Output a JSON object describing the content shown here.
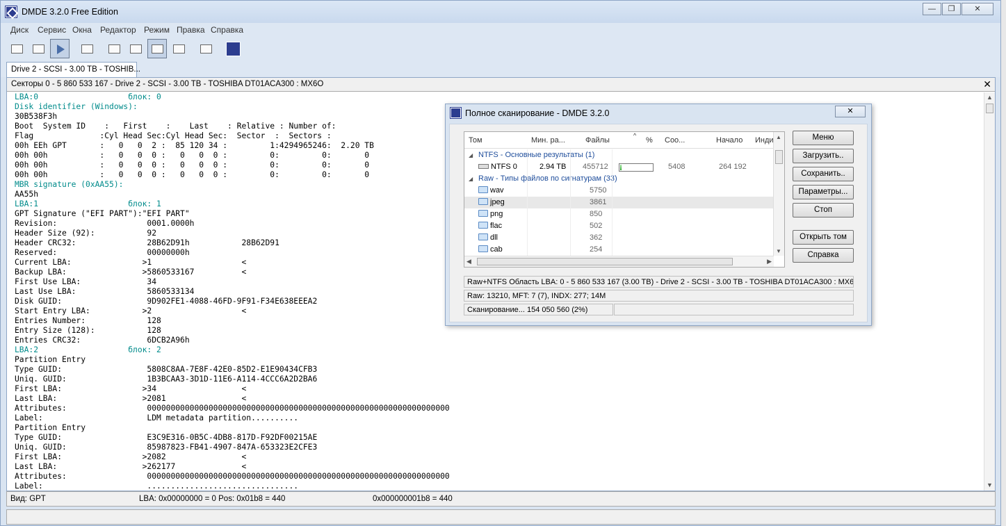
{
  "window": {
    "title": "DMDE 3.2.0 Free Edition",
    "minimize": "—",
    "restore": "❐",
    "close": "✕"
  },
  "menu": [
    "Диск",
    "Сервис",
    "Окна",
    "Редактор",
    "Режим",
    "Правка",
    "Справка"
  ],
  "tab": {
    "label": "Drive 2 - SCSI - 3.00 TB - TOSHIB..."
  },
  "panel": {
    "header": "Секторы 0 - 5 860 533 167 - Drive 2 - SCSI - 3.00 TB - TOSHIBA DT01ACA300 : MX6O",
    "close": "✕"
  },
  "hex_lines": [
    "LBA:0                   блок: 0",
    "Disk identifier (Windows):",
    "30B538F3h",
    "Boot  System ID    :   First    :    Last    : Relative : Number of:",
    "Flag              :Cyl Head Sec:Cyl Head Sec:  Sector  :  Sectors :",
    "00h EEh GPT       :   0   0  2 :  85 120 34 :         1:4294965246:  2.20 TB",
    "00h 00h           :   0   0  0 :   0   0  0 :         0:         0:       0",
    "00h 00h           :   0   0  0 :   0   0  0 :         0:         0:       0",
    "00h 00h           :   0   0  0 :   0   0  0 :         0:         0:       0",
    "MBR signature (0xAA55):",
    "AA55h",
    "LBA:1                   блок: 1",
    "GPT Signature (\"EFI PART\"):\"EFI PART\"",
    "Revision:                   0001.0000h",
    "Header Size (92):           92",
    "Header CRC32:               28B62D91h           28B62D91",
    "Reserved:                   00000000h",
    "Current LBA:               >1                   <",
    "Backup LBA:                >5860533167          <",
    "First Use LBA:              34",
    "Last Use LBA:               5860533134",
    "Disk GUID:                  9D902FE1-4088-46FD-9F91-F34E638EEEA2",
    "Start Entry LBA:           >2                   <",
    "Entries Number:             128",
    "Entry Size (128):           128",
    "Entries CRC32:              6DCB2A96h",
    "LBA:2                   блок: 2",
    "Partition Entry",
    "Type GUID:                  5808C8AA-7E8F-42E0-85D2-E1E90434CFB3",
    "Uniq. GUID:                 1B3BCAA3-3D1D-11E6-A114-4CCC6A2D2BA6",
    "First LBA:                 >34                  <",
    "Last LBA:                  >2081                <",
    "Attributes:                 0000000000000000000000000000000000000000000000000000000000000000",
    "Label:                      LDM metadata partition..........",
    "Partition Entry",
    "Type GUID:                  E3C9E316-0B5C-4DB8-817D-F92DF00215AE",
    "Uniq. GUID:                 85987823-FB41-4907-847A-653323E2CFE3",
    "First LBA:                 >2082                <",
    "Last LBA:                  >262177              <",
    "Attributes:                 0000000000000000000000000000000000000000000000000000000000000000",
    "Label:                      ................................"
  ],
  "status": {
    "view": "Вид: GPT",
    "lba": "LBA: 0x00000000 = 0  Pos: 0x01b8 = 440",
    "offset": "0x000000001b8 = 440"
  },
  "dialog": {
    "title": "Полное сканирование - DMDE 3.2.0",
    "close": "✕",
    "columns": [
      "Том",
      "Мин. ра...",
      "Файлы",
      "%",
      "Соо...",
      "Начало",
      "Инди"
    ],
    "sort_mark": "^",
    "groups": [
      {
        "label": "NTFS - Основные результаты (1)"
      },
      {
        "label": "Raw - Типы файлов по сигнатурам (33)"
      }
    ],
    "ntfs_row": {
      "name": "NTFS 0",
      "size": "2.94 TB",
      "files": "455712",
      "progress": 0.05,
      "match": "5408",
      "start": "264 192"
    },
    "raw_rows": [
      {
        "name": "wav",
        "files": "5750"
      },
      {
        "name": "jpeg",
        "files": "3861"
      },
      {
        "name": "png",
        "files": "850"
      },
      {
        "name": "flac",
        "files": "502"
      },
      {
        "name": "dll",
        "files": "362"
      },
      {
        "name": "cab",
        "files": "254"
      }
    ],
    "buttons": [
      "Меню",
      "Загрузить..",
      "Сохранить..",
      "Параметры...",
      "Стоп",
      "Открыть том",
      "Справка"
    ],
    "info1": "Raw+NTFS Область LBA: 0 - 5 860 533 167 (3.00 TB) - Drive 2 - SCSI - 3.00 TB - TOSHIBA DT01ACA300 : MX6O",
    "info2": "Raw: 13210, MFT: 7 (7), INDX: 277; 14M",
    "info3": "Сканирование... 154 050 560 (2%)"
  }
}
